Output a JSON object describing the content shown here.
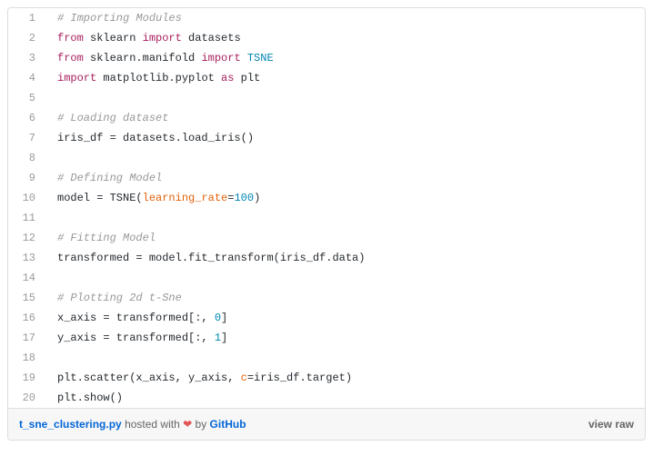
{
  "code": {
    "lines": [
      {
        "n": "1",
        "tokens": [
          [
            "# Importing Modules",
            "comment"
          ]
        ]
      },
      {
        "n": "2",
        "tokens": [
          [
            "from ",
            "keyword"
          ],
          [
            "sklearn ",
            "default"
          ],
          [
            "import",
            "keyword"
          ],
          [
            " datasets",
            "default"
          ]
        ]
      },
      {
        "n": "3",
        "tokens": [
          [
            "from ",
            "keyword"
          ],
          [
            "sklearn.manifold ",
            "default"
          ],
          [
            "import",
            "keyword"
          ],
          [
            " ",
            "default"
          ],
          [
            "TSNE",
            "builtin"
          ]
        ]
      },
      {
        "n": "4",
        "tokens": [
          [
            "import",
            "keyword"
          ],
          [
            " matplotlib.pyplot ",
            "default"
          ],
          [
            "as",
            "keyword"
          ],
          [
            " plt",
            "default"
          ]
        ]
      },
      {
        "n": "5",
        "tokens": [
          [
            "",
            "default"
          ]
        ]
      },
      {
        "n": "6",
        "tokens": [
          [
            "# Loading dataset",
            "comment"
          ]
        ]
      },
      {
        "n": "7",
        "tokens": [
          [
            "iris_df = datasets.load_iris()",
            "default"
          ]
        ]
      },
      {
        "n": "8",
        "tokens": [
          [
            "",
            "default"
          ]
        ]
      },
      {
        "n": "9",
        "tokens": [
          [
            "# Defining Model",
            "comment"
          ]
        ]
      },
      {
        "n": "10",
        "tokens": [
          [
            "model = TSNE(",
            "default"
          ],
          [
            "learning_rate",
            "param"
          ],
          [
            "=",
            "default"
          ],
          [
            "100",
            "number"
          ],
          [
            ")",
            "default"
          ]
        ]
      },
      {
        "n": "11",
        "tokens": [
          [
            "",
            "default"
          ]
        ]
      },
      {
        "n": "12",
        "tokens": [
          [
            "# Fitting Model",
            "comment"
          ]
        ]
      },
      {
        "n": "13",
        "tokens": [
          [
            "transformed = model.fit_transform(iris_df.data)",
            "default"
          ]
        ]
      },
      {
        "n": "14",
        "tokens": [
          [
            "",
            "default"
          ]
        ]
      },
      {
        "n": "15",
        "tokens": [
          [
            "# Plotting 2d t-Sne",
            "comment"
          ]
        ]
      },
      {
        "n": "16",
        "tokens": [
          [
            "x_axis = transformed[:, ",
            "default"
          ],
          [
            "0",
            "number"
          ],
          [
            "]",
            "default"
          ]
        ]
      },
      {
        "n": "17",
        "tokens": [
          [
            "y_axis = transformed[:, ",
            "default"
          ],
          [
            "1",
            "number"
          ],
          [
            "]",
            "default"
          ]
        ]
      },
      {
        "n": "18",
        "tokens": [
          [
            "",
            "default"
          ]
        ]
      },
      {
        "n": "19",
        "tokens": [
          [
            "plt.scatter(x_axis, y_axis, ",
            "default"
          ],
          [
            "c",
            "param"
          ],
          [
            "=iris_df.target)",
            "default"
          ]
        ]
      },
      {
        "n": "20",
        "tokens": [
          [
            "plt.show()",
            "default"
          ]
        ]
      }
    ]
  },
  "footer": {
    "filename": "t_sne_clustering.py",
    "hosted_with": " hosted with ",
    "heart": "❤",
    "by": " by ",
    "host": "GitHub",
    "view_raw": "view raw"
  }
}
